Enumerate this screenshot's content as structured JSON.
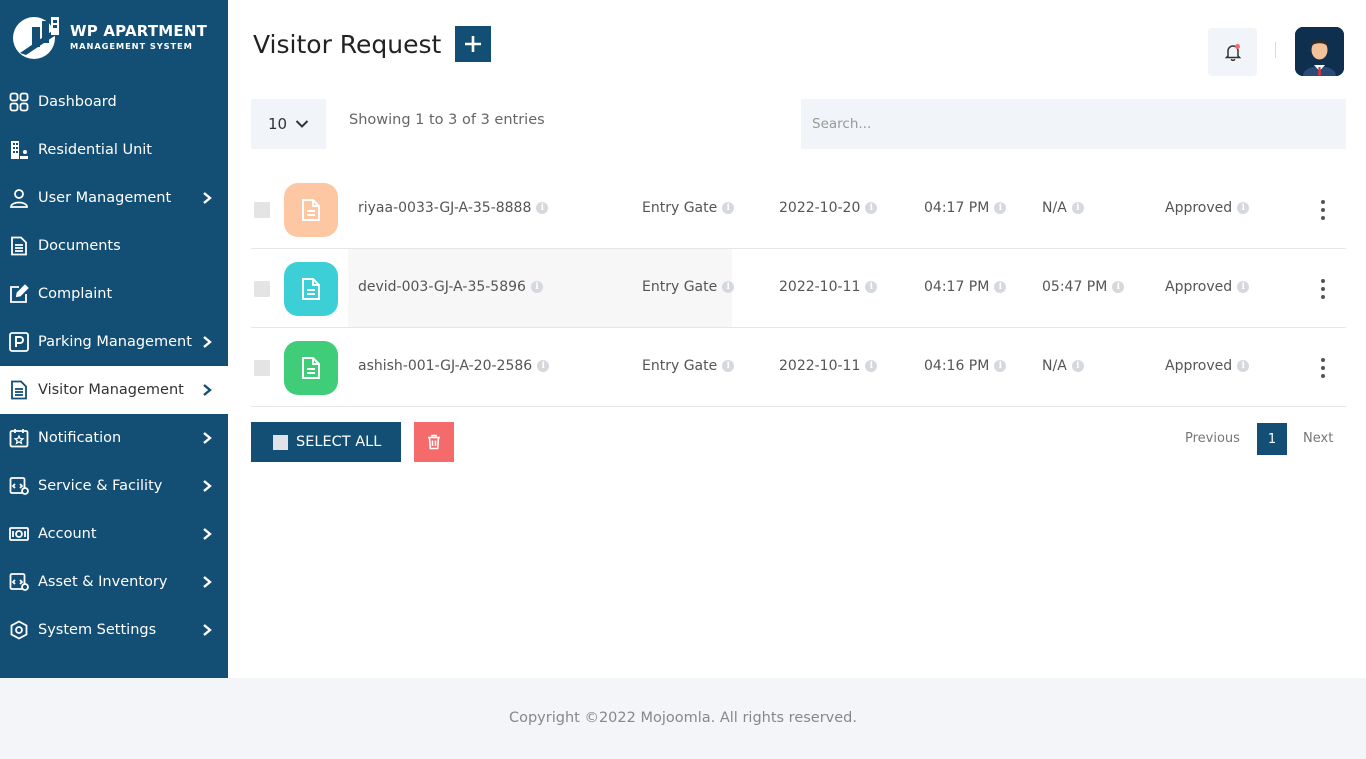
{
  "brand": {
    "title": "WP APARTMENT",
    "subtitle": "MANAGEMENT SYSTEM"
  },
  "sidebar": {
    "items": [
      {
        "label": "Dashboard",
        "icon": "grid-icon",
        "has_arrow": false
      },
      {
        "label": "Residential Unit",
        "icon": "building-icon",
        "has_arrow": false
      },
      {
        "label": "User Management",
        "icon": "user-icon",
        "has_arrow": true
      },
      {
        "label": "Documents",
        "icon": "document-icon",
        "has_arrow": false
      },
      {
        "label": "Complaint",
        "icon": "edit-icon",
        "has_arrow": false
      },
      {
        "label": "Parking Management",
        "icon": "parking-icon",
        "has_arrow": true
      },
      {
        "label": "Visitor Management",
        "icon": "document-icon",
        "has_arrow": true,
        "active": true
      },
      {
        "label": "Notification",
        "icon": "calendar-star-icon",
        "has_arrow": true
      },
      {
        "label": "Service & Facility",
        "icon": "service-icon",
        "has_arrow": true
      },
      {
        "label": "Account",
        "icon": "money-icon",
        "has_arrow": true
      },
      {
        "label": "Asset & Inventory",
        "icon": "asset-icon",
        "has_arrow": true
      },
      {
        "label": "System Settings",
        "icon": "settings-icon",
        "has_arrow": true
      }
    ]
  },
  "header": {
    "title": "Visitor Request",
    "add_label": "+"
  },
  "controls": {
    "page_size": "10",
    "showing": "Showing 1 to 3 of 3 entries",
    "search_placeholder": "Search..."
  },
  "table": {
    "rows": [
      {
        "name": "riyaa-0033-GJ-A-35-8888",
        "gate": "Entry Gate",
        "date": "2022-10-20",
        "in_time": "04:17 PM",
        "out_time": "N/A",
        "status": "Approved",
        "icon_color": "#fdc7a4"
      },
      {
        "name": "devid-003-GJ-A-35-5896",
        "gate": "Entry Gate",
        "date": "2022-10-11",
        "in_time": "04:17 PM",
        "out_time": "05:47 PM",
        "status": "Approved",
        "icon_color": "#3ccfd6"
      },
      {
        "name": "ashish-001-GJ-A-20-2586",
        "gate": "Entry Gate",
        "date": "2022-10-11",
        "in_time": "04:16 PM",
        "out_time": "N/A",
        "status": "Approved",
        "icon_color": "#3fcd7a"
      }
    ]
  },
  "actions": {
    "select_all": "SELECT ALL"
  },
  "pager": {
    "previous": "Previous",
    "page": "1",
    "next": "Next"
  },
  "footer": {
    "copyright": "Copyright ©2022 Mojoomla. All rights reserved."
  },
  "colors": {
    "primary": "#134e74",
    "danger": "#f56b6b",
    "panel": "#f1f4f8"
  }
}
